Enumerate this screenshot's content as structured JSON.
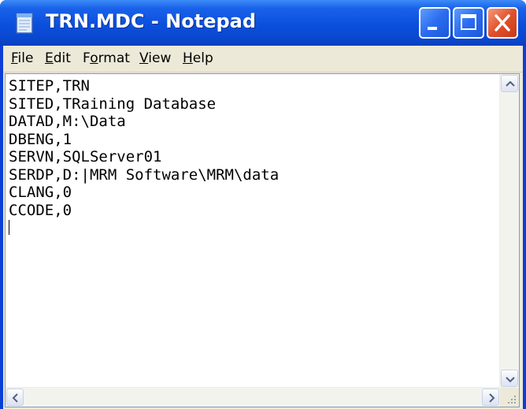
{
  "window": {
    "title": "TRN.MDC - Notepad"
  },
  "menu": {
    "file": {
      "prefix": "",
      "accel": "F",
      "rest": "ile"
    },
    "edit": {
      "prefix": "",
      "accel": "E",
      "rest": "dit"
    },
    "format": {
      "prefix": "F",
      "accel": "o",
      "rest": "rmat"
    },
    "view": {
      "prefix": "",
      "accel": "V",
      "rest": "iew"
    },
    "help": {
      "prefix": "",
      "accel": "H",
      "rest": "elp"
    }
  },
  "document": {
    "lines": [
      "SITEP,TRN",
      "SITED,TRaining Database",
      "DATAD,M:\\Data",
      "DBENG,1",
      "SERVN,SQLServer01",
      "SERDP,D:|MRM Software\\MRM\\data",
      "CLANG,0",
      "CCODE,0"
    ]
  },
  "colors": {
    "titlebar": "#0b4fdc",
    "close_button": "#e2512c",
    "menubar": "#ece9d8"
  },
  "icons": {
    "app": "notepad-icon",
    "minimize": "minimize-icon",
    "maximize": "maximize-icon",
    "close": "close-icon",
    "scroll_up": "arrow-up-icon",
    "scroll_down": "arrow-down-icon",
    "scroll_left": "arrow-left-icon",
    "scroll_right": "arrow-right-icon",
    "resize": "resize-grip-icon"
  }
}
